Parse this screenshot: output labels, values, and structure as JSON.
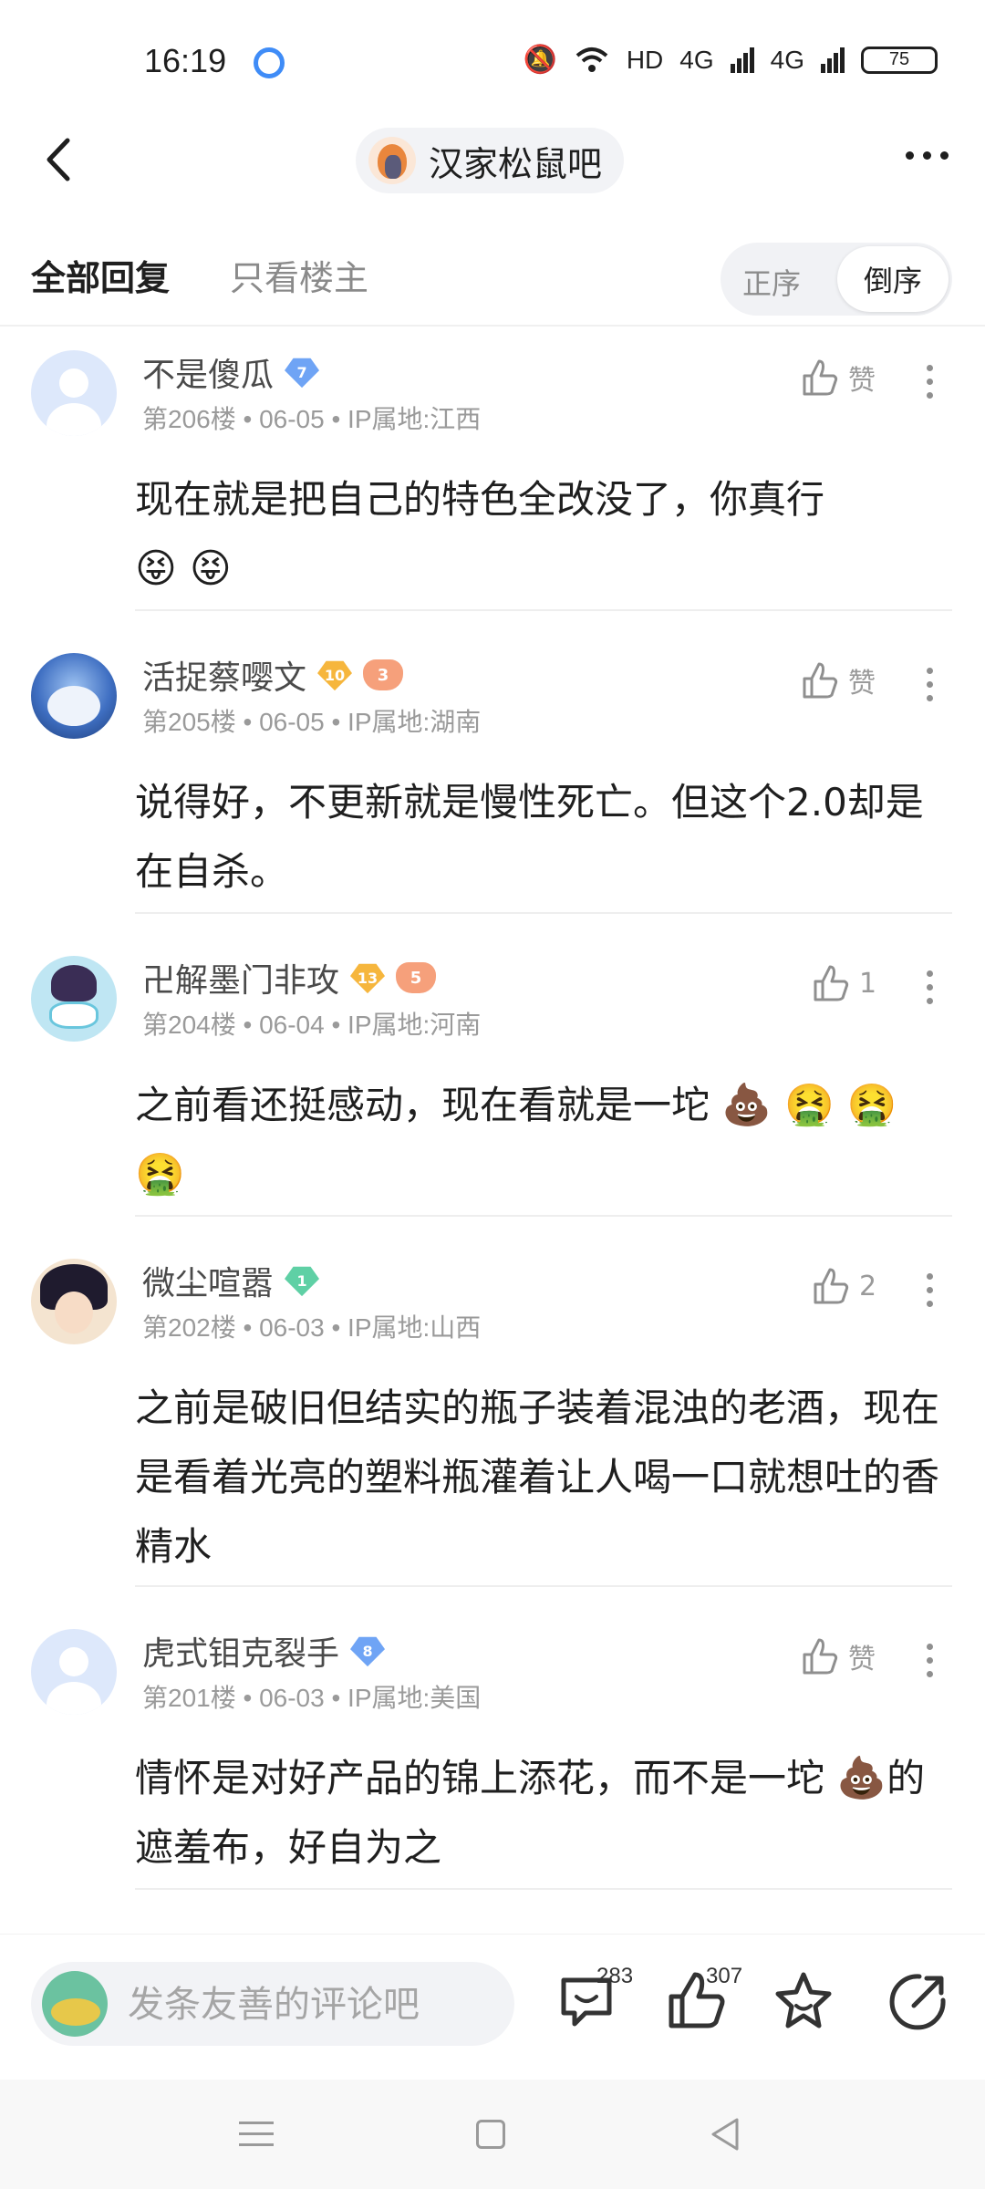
{
  "status_bar": {
    "time": "16:19",
    "hd_label": "HD",
    "network_1": "4G",
    "network_2": "4G",
    "battery": "75"
  },
  "header": {
    "forum_name": "汉家松鼠吧"
  },
  "tabs": {
    "all_replies": "全部回复",
    "op_only": "只看楼主",
    "sort_asc": "正序",
    "sort_desc": "倒序"
  },
  "comments": [
    {
      "username": "不是傻瓜",
      "level": "7",
      "meta": "第206楼 • 06-05 • IP属地:江西",
      "like": "赞",
      "content": "现在就是把自己的特色全改没了，你真行",
      "emojis": "😝 😝"
    },
    {
      "username": "活捉蔡嘤文",
      "level": "10",
      "fan_level": "3",
      "meta": "第205楼 • 06-05 • IP属地:湖南",
      "like": "赞",
      "content": "说得好，不更新就是慢性死亡。但这个2.0却是在自杀。"
    },
    {
      "username": "卍解墨门非攻",
      "level": "13",
      "fan_level": "5",
      "meta": "第204楼 • 06-04 • IP属地:河南",
      "like": "1",
      "content": "之前看还挺感动，现在看就是一坨",
      "emojis": "💩 🤮 🤮 🤮"
    },
    {
      "username": "微尘喧嚣",
      "level": "1",
      "meta": "第202楼 • 06-03 • IP属地:山西",
      "like": "2",
      "content": "之前是破旧但结实的瓶子装着混浊的老酒，现在是看着光亮的塑料瓶灌着让人喝一口就想吐的香精水"
    },
    {
      "username": "虎式钼克裂手",
      "level": "8",
      "meta": "第201楼 • 06-03 • IP属地:美国",
      "like": "赞",
      "content_prefix": "情怀是对好产品的锦上添花，而不是一坨",
      "content_emoji": "💩",
      "content_suffix": "的遮羞布，好自为之"
    }
  ],
  "bottom_bar": {
    "input_placeholder": "发条友善的评论吧",
    "comment_count": "283",
    "like_count": "307"
  }
}
